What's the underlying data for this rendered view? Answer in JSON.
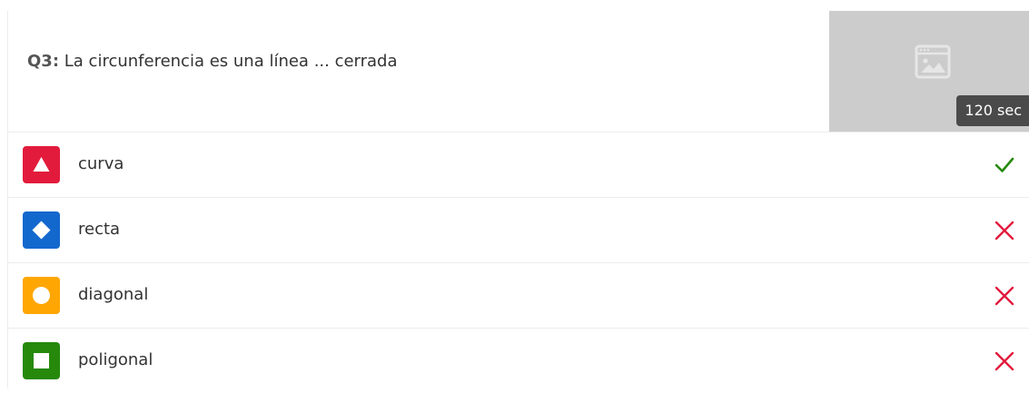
{
  "question": {
    "number_label": "Q3:",
    "text": "La circunferencia es una línea ... cerrada",
    "time_badge": "120 sec",
    "image_icon": "image-placeholder-icon"
  },
  "answers": [
    {
      "label": "curva",
      "shape": "triangle-icon",
      "color": "#e21b3c",
      "result": "correct",
      "mark_icon": "check-icon",
      "mark_color": "#26890c"
    },
    {
      "label": "recta",
      "shape": "diamond-icon",
      "color": "#1368ce",
      "result": "incorrect",
      "mark_icon": "cross-icon",
      "mark_color": "#e21b3c"
    },
    {
      "label": "diagonal",
      "shape": "circle-icon",
      "color": "#ffa602",
      "result": "incorrect",
      "mark_icon": "cross-icon",
      "mark_color": "#e21b3c"
    },
    {
      "label": "poligonal",
      "shape": "square-icon",
      "color": "#26890c",
      "result": "incorrect",
      "mark_icon": "cross-icon",
      "mark_color": "#e21b3c"
    }
  ]
}
